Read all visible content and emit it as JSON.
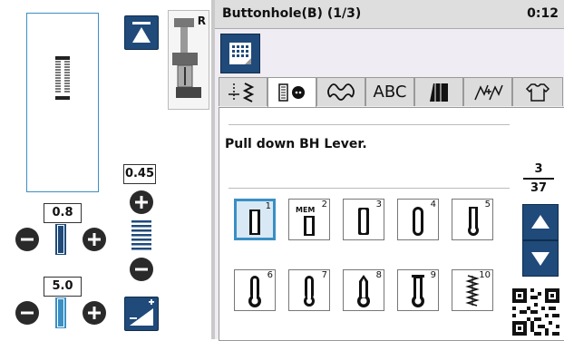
{
  "left_panel": {
    "width_value": "0.45",
    "length_value": "0.8",
    "density_value": "5.0",
    "foot_label": "R"
  },
  "header": {
    "title": "Buttonhole(B)  (1/3)",
    "time": "0:12"
  },
  "tabs": [
    {
      "name": "utility-stitch-icon"
    },
    {
      "name": "buttonhole-icon",
      "active": true
    },
    {
      "name": "decorative-stitch-icon"
    },
    {
      "name": "alphabet",
      "label": "ABC"
    },
    {
      "name": "satin-stitch-icon"
    },
    {
      "name": "cross-stitch-icon"
    },
    {
      "name": "shirt-icon"
    }
  ],
  "message": "Pull down BH Lever.",
  "pagination": {
    "current": "3",
    "total": "37"
  },
  "stitches": [
    {
      "num": "1",
      "selected": true
    },
    {
      "num": "2",
      "mem": "MEM"
    },
    {
      "num": "3"
    },
    {
      "num": "4"
    },
    {
      "num": "5"
    },
    {
      "num": "6"
    },
    {
      "num": "7"
    },
    {
      "num": "8"
    },
    {
      "num": "9"
    },
    {
      "num": "10"
    }
  ],
  "colors": {
    "accent": "#1f4a7a",
    "selection": "#3a8fc4"
  }
}
